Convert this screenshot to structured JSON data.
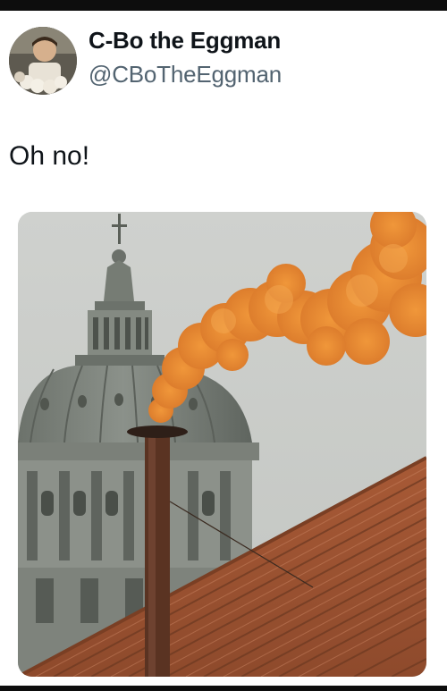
{
  "tweet": {
    "author_name": "C-Bo the Eggman",
    "author_handle": "@CBoTheEggman",
    "text": "Oh no!"
  },
  "media": {
    "description_icon": "photo-icon"
  },
  "colors": {
    "text_primary": "#0f1419",
    "text_secondary": "#536471",
    "smoke": "#e58a2a",
    "roof": "#b4643f",
    "dome": "#7d837c",
    "sky": "#c9ccc8"
  }
}
